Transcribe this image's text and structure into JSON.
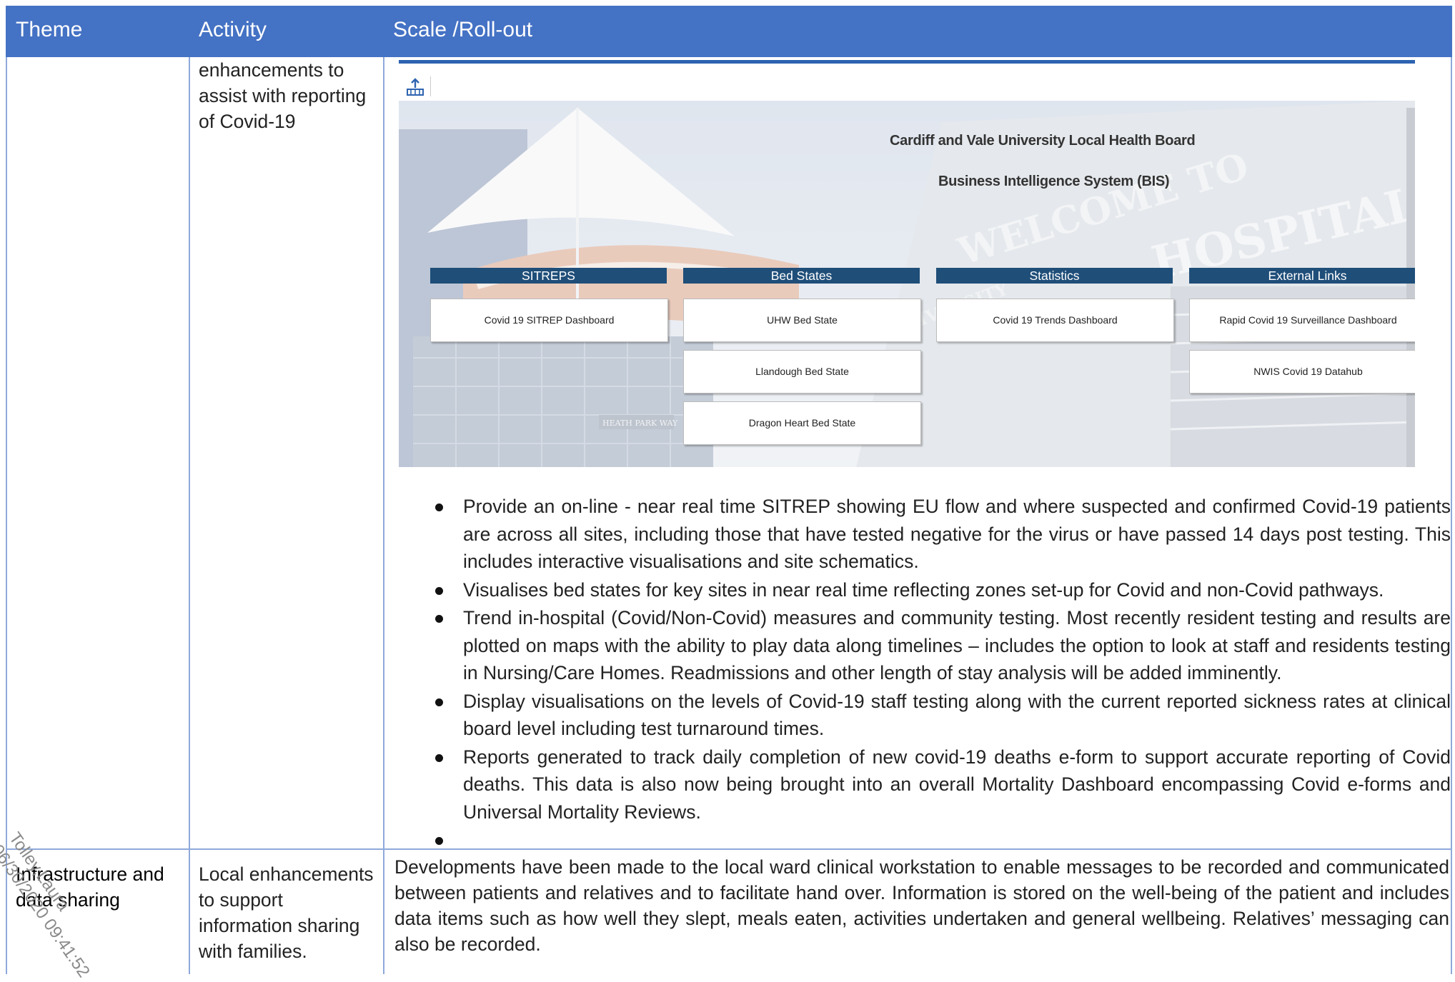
{
  "header": {
    "theme": "Theme",
    "activity": "Activity",
    "scale": "Scale /Roll-out"
  },
  "row1": {
    "activity_lines": [
      "enhancements  to",
      "assist with reporting",
      "of Covid-19"
    ],
    "bis": {
      "title": "Cardiff and Vale University Local Health Board",
      "subtitle": "Business Intelligence System (BIS)",
      "background_text": [
        "WELCOME TO",
        "HOSPITAL OF WALES",
        "UNIVERSITY",
        "HEATH PARK WAY"
      ],
      "columns": [
        {
          "heading": "SITREPS",
          "buttons": [
            "Covid 19 SITREP Dashboard"
          ]
        },
        {
          "heading": "Bed States",
          "buttons": [
            "UHW Bed State",
            "Llandough Bed State",
            "Dragon Heart Bed State"
          ]
        },
        {
          "heading": "Statistics",
          "buttons": [
            "Covid 19 Trends Dashboard"
          ]
        },
        {
          "heading": "External Links",
          "buttons": [
            "Rapid Covid 19 Surveillance Dashboard",
            "NWIS Covid 19 Datahub"
          ]
        }
      ],
      "toolbar_icon": "export-icon"
    },
    "bullets": [
      "Provide an on-line - near real time SITREP showing EU flow and where suspected and confirmed Covid-19 patients are across all sites, including those that have tested negative for the virus or have passed 14 days post testing.  This includes interactive visualisations and site schematics.",
      "Visualises bed states for key sites in near real time reflecting zones set-up for Covid and non-Covid pathways.",
      "Trend in-hospital (Covid/Non-Covid) measures and community testing. Most recently resident testing and results are plotted on maps with the ability to play data along timelines – includes the option to look at staff and residents testing in Nursing/Care Homes. Readmissions and other length of stay analysis will be added imminently.",
      "Display visualisations on the levels of Covid-19 staff testing along with the current reported sickness rates at clinical board level including test turnaround times.",
      "Reports generated to track daily completion of new covid-19 deaths e-form to support accurate reporting of Covid deaths. This data is also now being brought into an overall Mortality Dashboard encompassing Covid e-forms and Universal Mortality Reviews.",
      ""
    ]
  },
  "row2": {
    "theme_lines": [
      "Infrastructure and",
      "data sharing"
    ],
    "activity_lines": [
      "Local enhancements",
      "to support",
      "information sharing",
      "with families."
    ],
    "description": "Developments have been made to the local ward clinical workstation to enable messages to be recorded and communicated between patients and relatives and to facilitate hand over. Information is stored on the well-being of the patient and includes data items such as how well they slept, meals eaten, activities undertaken and general wellbeing. Relatives’ messaging can also be recorded."
  },
  "watermark": {
    "name": "Tolley,Laura",
    "timestamp": "06/30/2020 09:41:52"
  }
}
